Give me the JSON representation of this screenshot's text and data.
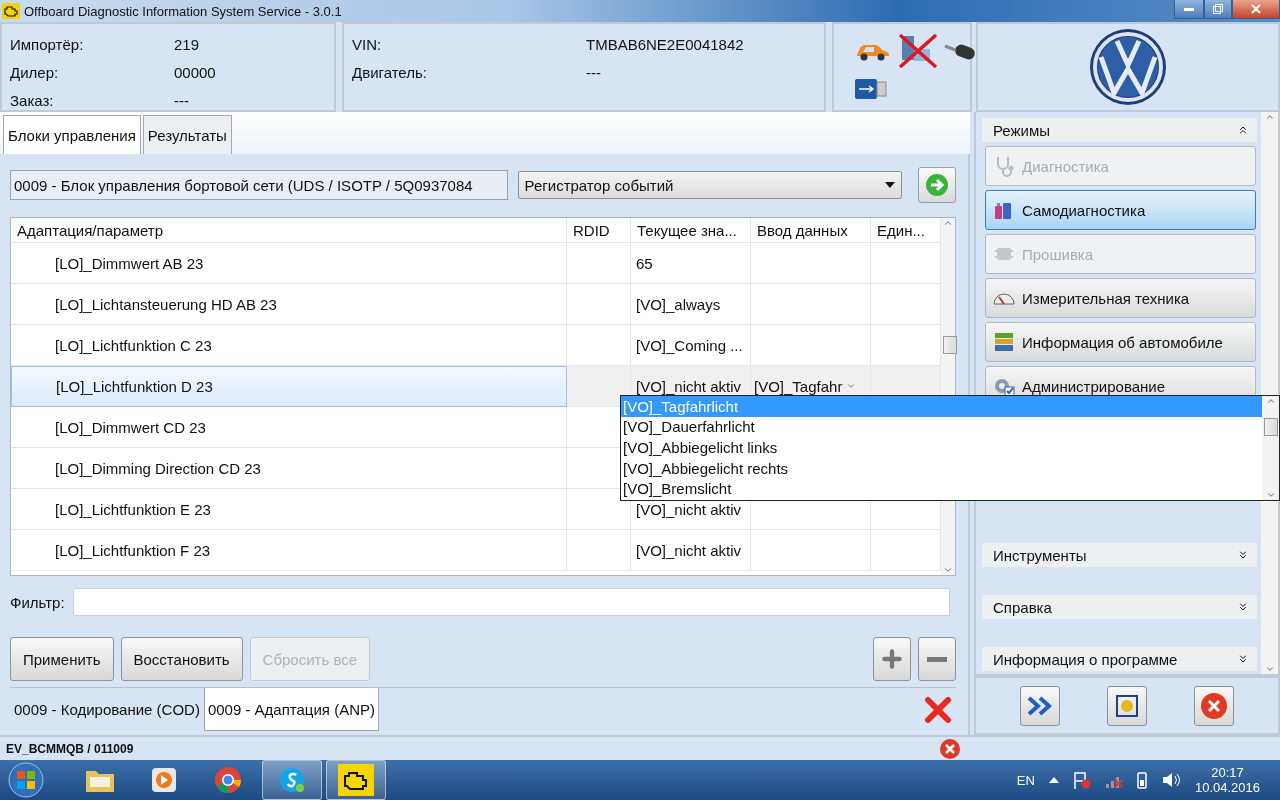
{
  "window": {
    "title": "Offboard Diagnostic Information System Service - 3.0.1"
  },
  "dealer_info": [
    {
      "label": "Импортёр:",
      "value": "219"
    },
    {
      "label": "Дилер:",
      "value": "00000"
    },
    {
      "label": "Заказ:",
      "value": "---"
    }
  ],
  "vehicle_info": [
    {
      "label": "VIN:",
      "value": "TMBAB6NE2E0041842"
    },
    {
      "label": "Двигатель:",
      "value": "---"
    }
  ],
  "tabs": [
    {
      "label": "Блоки управления",
      "selected": true
    },
    {
      "label": "Результаты",
      "selected": false
    }
  ],
  "module_field": {
    "value": "0009 - Блок управления бортовой сети  (UDS / ISOTP / 5Q0937084"
  },
  "function_dropdown": {
    "value": "Регистратор событий"
  },
  "table": {
    "columns": [
      "Адаптация/параметр",
      "RDID",
      "Текущее зна...",
      "Ввод данных",
      "Един..."
    ],
    "rows": [
      {
        "parameter": "[LO]_Dimmwert AB 23",
        "current": "65",
        "selected": false
      },
      {
        "parameter": "[LO]_Lichtansteuerung HD AB 23",
        "current": "[VO]_always",
        "selected": false
      },
      {
        "parameter": "[LO]_Lichtfunktion C 23",
        "current": "[VO]_Coming ...",
        "selected": false
      },
      {
        "parameter": "[LO]_Lichtfunktion D 23",
        "current": "[VO]_nicht aktiv",
        "input": "[VO]_Tagfahr",
        "selected": true
      },
      {
        "parameter": "[LO]_Dimmwert CD 23",
        "selected": false
      },
      {
        "parameter": "[LO]_Dimming Direction CD 23",
        "selected": false
      },
      {
        "parameter": "[LO]_Lichtfunktion E 23",
        "current": "[VO]_nicht aktiv",
        "selected": false
      },
      {
        "parameter": "[LO]_Lichtfunktion F 23",
        "current": "[VO]_nicht aktiv",
        "selected": false
      }
    ]
  },
  "dropdown_list": [
    {
      "label": "[VO]_Tagfahrlicht",
      "selected": true
    },
    {
      "label": "[VO]_Dauerfahrlicht",
      "selected": false
    },
    {
      "label": "[VO]_Abbiegelicht links",
      "selected": false
    },
    {
      "label": "[VO]_Abbiegelicht rechts",
      "selected": false
    },
    {
      "label": "[VO]_Bremslicht",
      "selected": false
    }
  ],
  "filter": {
    "label": "Фильтр:"
  },
  "buttons": [
    {
      "label": "Применить",
      "disabled": false
    },
    {
      "label": "Восстановить",
      "disabled": false
    },
    {
      "label": "Сбросить все",
      "disabled": true
    }
  ],
  "bottom_tabs": [
    {
      "label": "0009 - Кодирование (COD)",
      "selected": false
    },
    {
      "label": "0009 - Адаптация (ANP)",
      "selected": true
    }
  ],
  "sidebar": {
    "modes": {
      "title": "Режимы",
      "expanded": true,
      "items": [
        {
          "label": "Диагностика",
          "kind": "stethoscope",
          "selected": false,
          "disabled": true
        },
        {
          "label": "Самодиагностика",
          "kind": "bottles",
          "selected": true,
          "disabled": false
        },
        {
          "label": "Прошивка",
          "kind": "chip",
          "selected": false,
          "disabled": true
        },
        {
          "label": "Измерительная техника",
          "kind": "gauge",
          "selected": false,
          "disabled": false
        },
        {
          "label": "Информация об автомобиле",
          "kind": "books",
          "selected": false,
          "disabled": false
        },
        {
          "label": "Администрирование",
          "kind": "gear",
          "selected": false,
          "disabled": false
        }
      ]
    },
    "sections": [
      {
        "title": "Инструменты",
        "expanded": false
      },
      {
        "title": "Справка",
        "expanded": false
      },
      {
        "title": "Информация о программе",
        "expanded": false
      }
    ]
  },
  "status_bar": {
    "text": "EV_BCMMQB / 011009"
  },
  "taskbar": {
    "apps": [
      {
        "kind": "folder",
        "active": false
      },
      {
        "kind": "player",
        "active": false
      },
      {
        "kind": "browser",
        "active": false
      },
      {
        "kind": "messenger",
        "active": true
      },
      {
        "kind": "engine",
        "active": true
      }
    ],
    "language": "EN",
    "time": "20:17",
    "date": "10.04.2016"
  }
}
